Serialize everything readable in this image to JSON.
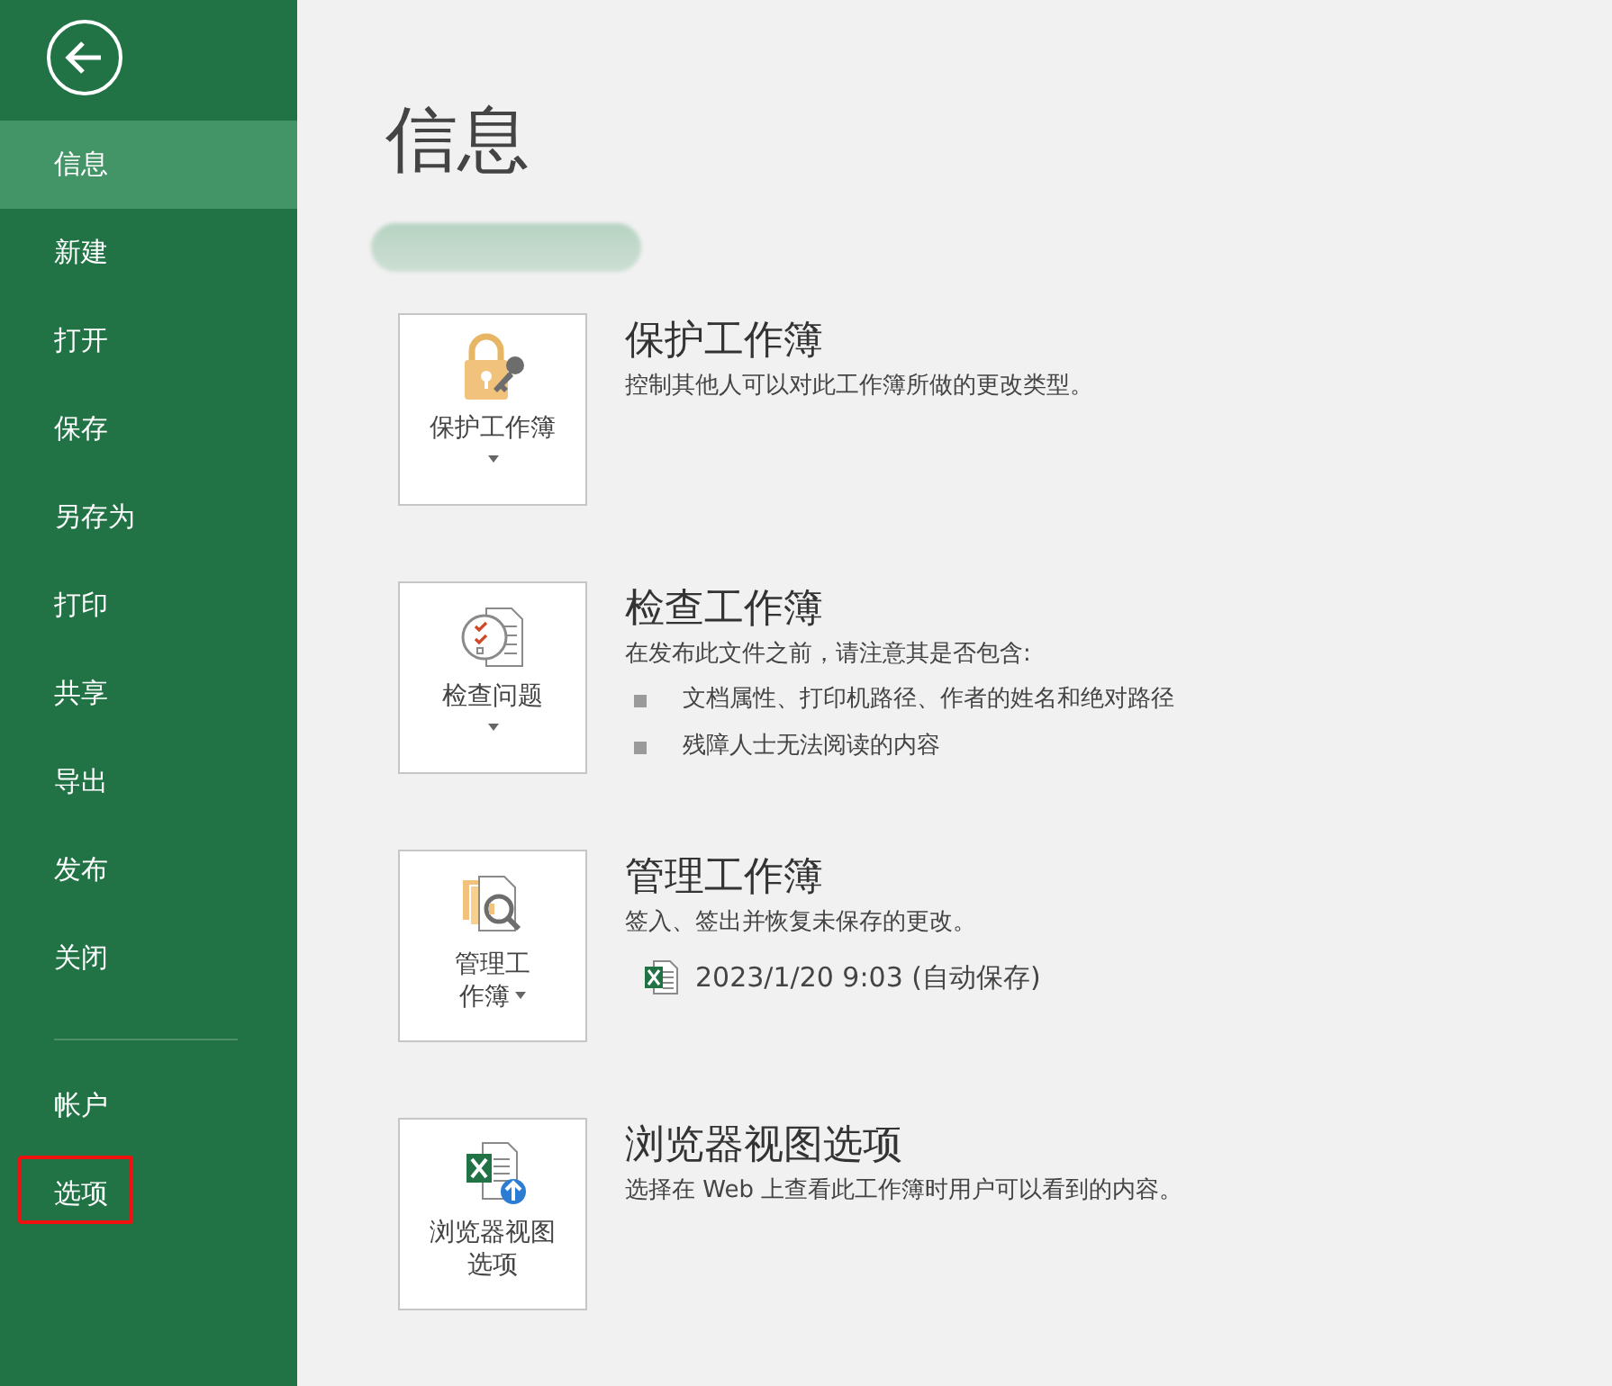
{
  "sidebar": {
    "items": [
      {
        "label": "信息",
        "selected": true,
        "highlighted": false
      },
      {
        "label": "新建",
        "selected": false,
        "highlighted": false
      },
      {
        "label": "打开",
        "selected": false,
        "highlighted": false
      },
      {
        "label": "保存",
        "selected": false,
        "highlighted": false
      },
      {
        "label": "另存为",
        "selected": false,
        "highlighted": false
      },
      {
        "label": "打印",
        "selected": false,
        "highlighted": false
      },
      {
        "label": "共享",
        "selected": false,
        "highlighted": false
      },
      {
        "label": "导出",
        "selected": false,
        "highlighted": false
      },
      {
        "label": "发布",
        "selected": false,
        "highlighted": false
      },
      {
        "label": "关闭",
        "selected": false,
        "highlighted": false
      }
    ],
    "bottom_items": [
      {
        "label": "帐户",
        "selected": false,
        "highlighted": false
      },
      {
        "label": "选项",
        "selected": false,
        "highlighted": true
      }
    ]
  },
  "page_title": "信息",
  "sections": [
    {
      "kind": "description",
      "button": {
        "label_lines": [
          "保护工作簿"
        ],
        "caret": true
      },
      "title": "保护工作簿",
      "description": "控制其他人可以对此工作簿所做的更改类型。"
    },
    {
      "kind": "bullets",
      "button": {
        "label_lines": [
          "检查问题"
        ],
        "caret": true
      },
      "title": "检查工作簿",
      "description": "在发布此文件之前，请注意其是否包含:",
      "bullets": [
        "文档属性、打印机路径、作者的姓名和绝对路径",
        "残障人士无法阅读的内容"
      ]
    },
    {
      "kind": "file",
      "button": {
        "label_lines": [
          "管理工",
          "作簿"
        ],
        "caret": true
      },
      "title": "管理工作簿",
      "description": "签入、签出并恢复未保存的更改。",
      "file": "2023/1/20 9:03 (自动保存)"
    },
    {
      "kind": "description",
      "button": {
        "label_lines": [
          "浏览器视图",
          "选项"
        ],
        "caret": false
      },
      "title": "浏览器视图选项",
      "description": "选择在 Web 上查看此工作簿时用户可以看到的内容。"
    }
  ]
}
